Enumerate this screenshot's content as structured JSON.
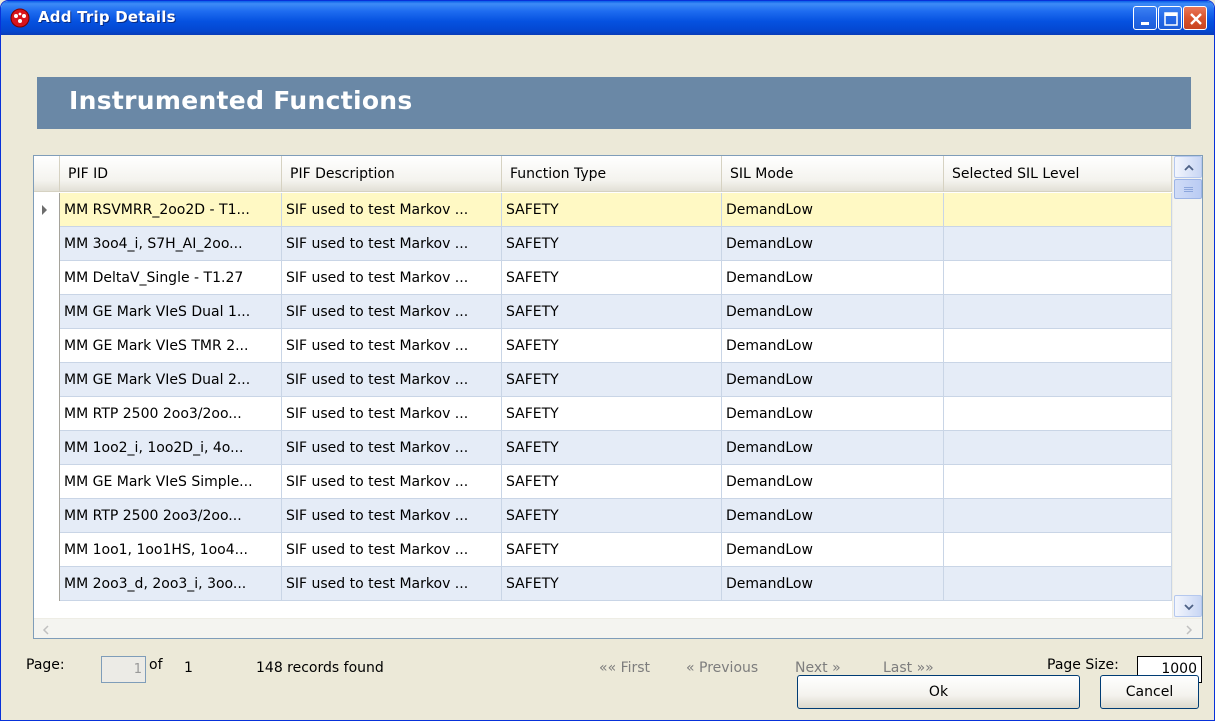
{
  "window": {
    "title": "Add Trip Details"
  },
  "section_title": "Instrumented Functions",
  "columns": [
    "PIF ID",
    "PIF Description",
    "Function Type",
    "SIL Mode",
    "Selected SIL Level"
  ],
  "rows": [
    {
      "id": "MM RSVMRR_2oo2D - T1...",
      "desc": "SIF used to test Markov ...",
      "type": "SAFETY",
      "mode": "DemandLow",
      "level": ""
    },
    {
      "id": "MM 3oo4_i, S7H_AI_2oo...",
      "desc": "SIF used to test Markov ...",
      "type": "SAFETY",
      "mode": "DemandLow",
      "level": ""
    },
    {
      "id": "MM DeltaV_Single - T1.27",
      "desc": "SIF used to test Markov ...",
      "type": "SAFETY",
      "mode": "DemandLow",
      "level": ""
    },
    {
      "id": "MM GE Mark VIeS Dual 1...",
      "desc": "SIF used to test Markov ...",
      "type": "SAFETY",
      "mode": "DemandLow",
      "level": ""
    },
    {
      "id": "MM GE Mark VIeS TMR 2...",
      "desc": "SIF used to test Markov ...",
      "type": "SAFETY",
      "mode": "DemandLow",
      "level": ""
    },
    {
      "id": "MM GE Mark VIeS Dual 2...",
      "desc": "SIF used to test Markov ...",
      "type": "SAFETY",
      "mode": "DemandLow",
      "level": ""
    },
    {
      "id": "MM RTP 2500 2oo3/2oo...",
      "desc": "SIF used to test Markov ...",
      "type": "SAFETY",
      "mode": "DemandLow",
      "level": ""
    },
    {
      "id": "MM 1oo2_i, 1oo2D_i, 4o...",
      "desc": "SIF used to test Markov ...",
      "type": "SAFETY",
      "mode": "DemandLow",
      "level": ""
    },
    {
      "id": "MM GE Mark VIeS Simple...",
      "desc": "SIF used to test Markov ...",
      "type": "SAFETY",
      "mode": "DemandLow",
      "level": ""
    },
    {
      "id": "MM RTP 2500 2oo3/2oo...",
      "desc": "SIF used to test Markov ...",
      "type": "SAFETY",
      "mode": "DemandLow",
      "level": ""
    },
    {
      "id": "MM 1oo1, 1oo1HS, 1oo4...",
      "desc": "SIF used to test Markov ...",
      "type": "SAFETY",
      "mode": "DemandLow",
      "level": ""
    },
    {
      "id": "MM 2oo3_d, 2oo3_i, 3oo...",
      "desc": "SIF used to test Markov ...",
      "type": "SAFETY",
      "mode": "DemandLow",
      "level": ""
    }
  ],
  "pager": {
    "page_label": "Page:",
    "page_value": "1",
    "of_label": "of",
    "total_pages": "1",
    "records": "148 records found",
    "first": "«« First",
    "previous": "« Previous",
    "next": "Next »",
    "last": "Last »»",
    "page_size_label": "Page Size:",
    "page_size_value": "1000"
  },
  "buttons": {
    "ok": "Ok",
    "cancel": "Cancel"
  },
  "colors": {
    "header_band": "#6a88a6",
    "selected_row": "#fff9c4",
    "alt_row": "#e5ecf7"
  }
}
